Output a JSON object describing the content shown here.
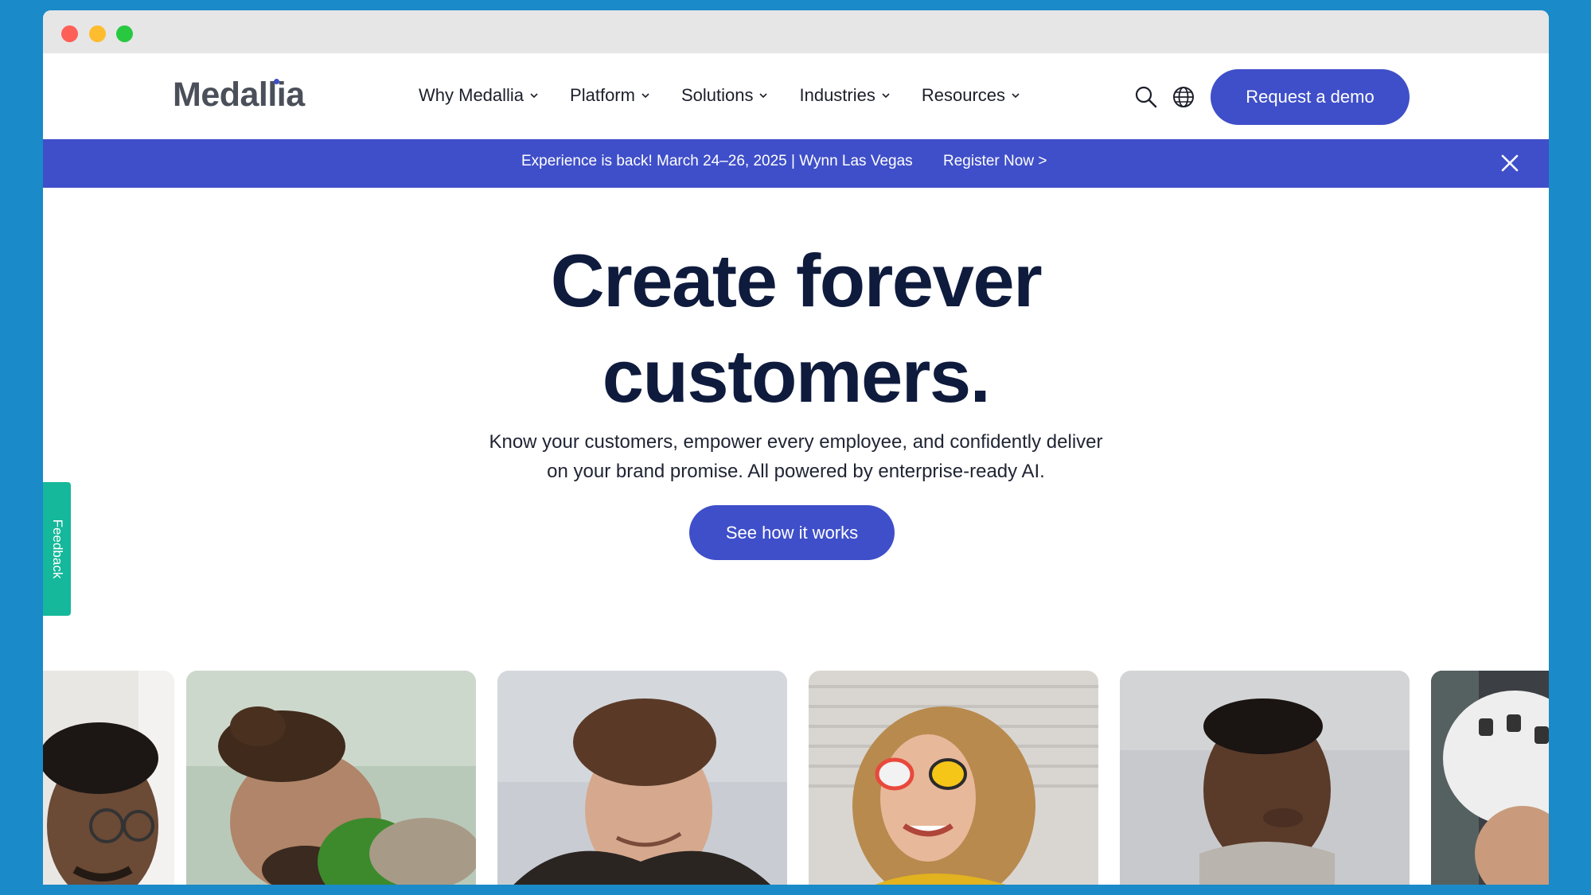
{
  "brand": {
    "name": "Medallia"
  },
  "nav": {
    "items": [
      {
        "label": "Why Medallia"
      },
      {
        "label": "Platform"
      },
      {
        "label": "Solutions"
      },
      {
        "label": "Industries"
      },
      {
        "label": "Resources"
      }
    ],
    "search_icon": "search-icon",
    "globe_icon": "globe-icon",
    "cta_label": "Request a demo"
  },
  "banner": {
    "text": "Experience is back! March 24–26, 2025 | Wynn Las Vegas",
    "link_label": "Register Now >"
  },
  "hero": {
    "title_line1": "Create forever",
    "title_line2": "customers.",
    "subtitle_line1": "Know your customers, empower every employee, and confidently deliver",
    "subtitle_line2": "on your brand promise. All powered by enterprise-ready AI.",
    "cta_label": "See how it works"
  },
  "feedback": {
    "label": "Feedback"
  },
  "colors": {
    "accent": "#3f4fc9",
    "heading": "#0f1b3d",
    "feedback": "#15b89a",
    "desktop": "#1a8ac9"
  }
}
